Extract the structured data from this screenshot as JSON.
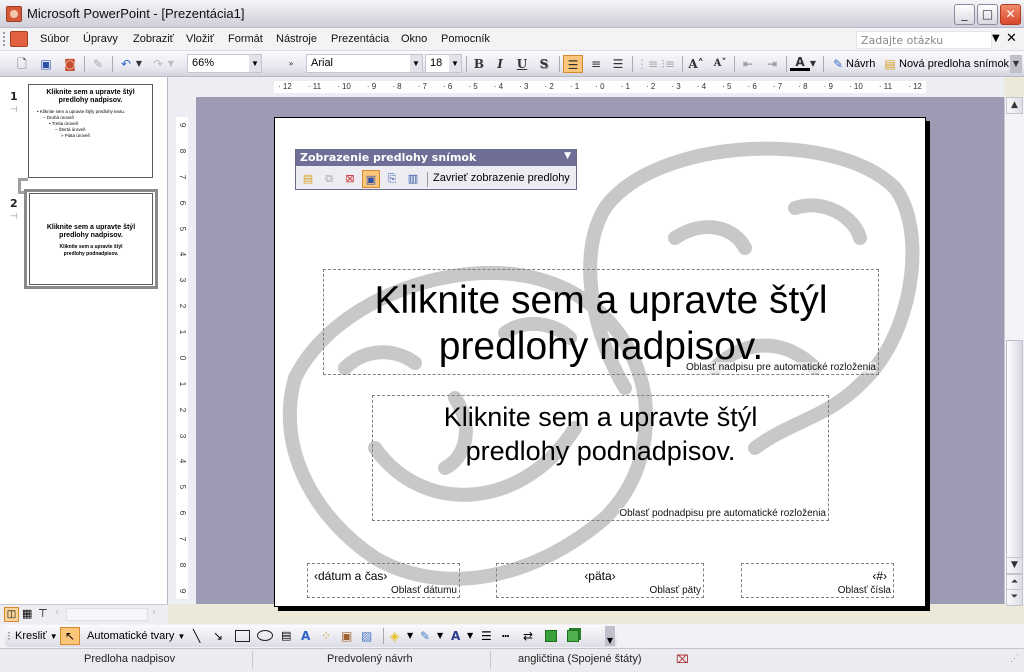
{
  "window": {
    "title": "Microsoft PowerPoint - [Prezentácia1]",
    "controls": {
      "minimize": "_",
      "maximize": "□",
      "close": "✕"
    }
  },
  "menu": {
    "items": [
      "Súbor",
      "Úpravy",
      "Zobraziť",
      "Vložiť",
      "Formát",
      "Nástroje",
      "Prezentácia",
      "Okno",
      "Pomocník"
    ],
    "ask_placeholder": "Zadajte otázku"
  },
  "toolbar": {
    "zoom": "66%",
    "font": "Arial",
    "font_size": "18",
    "bold": "B",
    "italic": "I",
    "underline": "U",
    "shadow": "S",
    "design_label": "Návrh",
    "new_master_label": "Nová predloha snímok"
  },
  "slides_pane": {
    "slides": [
      {
        "number": "1",
        "title": "Kliknite sem a upravte štýl predlohy nadpisov.",
        "body": [
          "• Kliknite sem a upravte štýly predlohy textu.",
          "– Druhá úroveň",
          "• Tretia úroveň",
          "– Štvrtá úroveň",
          "» Piata úroveň"
        ]
      },
      {
        "number": "2",
        "title": "Kliknite sem a upravte štýl predlohy nadpisov.",
        "subtitle": "Kliknite sem a upravte štýl predlohy podnadpisov.",
        "selected": true
      }
    ]
  },
  "ruler": {
    "horizontal": [
      "12",
      "11",
      "10",
      "9",
      "8",
      "7",
      "6",
      "5",
      "4",
      "3",
      "2",
      "1",
      "0",
      "1",
      "2",
      "3",
      "4",
      "5",
      "6",
      "7",
      "8",
      "9",
      "10",
      "11",
      "12"
    ],
    "vertical": [
      "9",
      "8",
      "7",
      "6",
      "5",
      "4",
      "3",
      "2",
      "1",
      "0",
      "1",
      "2",
      "3",
      "4",
      "5",
      "6",
      "7",
      "8",
      "9"
    ]
  },
  "master_toolbar": {
    "title": "Zobrazenie predlohy snímok",
    "close_label": "Zavrieť zobrazenie predlohy"
  },
  "slide": {
    "title_line1": "Kliknite sem a upravte štýl",
    "title_line2": "predlohy nadpisov.",
    "title_area_label": "Oblasť nadpisu pre automatické rozloženia",
    "subtitle_line1": "Kliknite sem a upravte štýl",
    "subtitle_line2": "predlohy podnadpisov.",
    "subtitle_area_label": "Oblasť podnadpisu pre automatické rozloženia",
    "date_placeholder": "‹dátum a čas›",
    "date_area_label": "Oblasť dátumu",
    "footer_placeholder": "‹päta›",
    "footer_area_label": "Oblasť päty",
    "number_placeholder": "‹#›",
    "number_area_label": "Oblasť čísla"
  },
  "draw_toolbar": {
    "draw_label": "Kresliť",
    "autoshapes_label": "Automatické tvary"
  },
  "statusbar": {
    "layout": "Predloha nadpisov",
    "design": "Predvolený návrh",
    "language": "angličtina (Spojené štáty)"
  },
  "colors": {
    "workspace": "#9d9bb4",
    "active_button": "#fbc57a",
    "master_toolbar_header": "#6e6e96",
    "watermark": "#c8c8c8"
  }
}
